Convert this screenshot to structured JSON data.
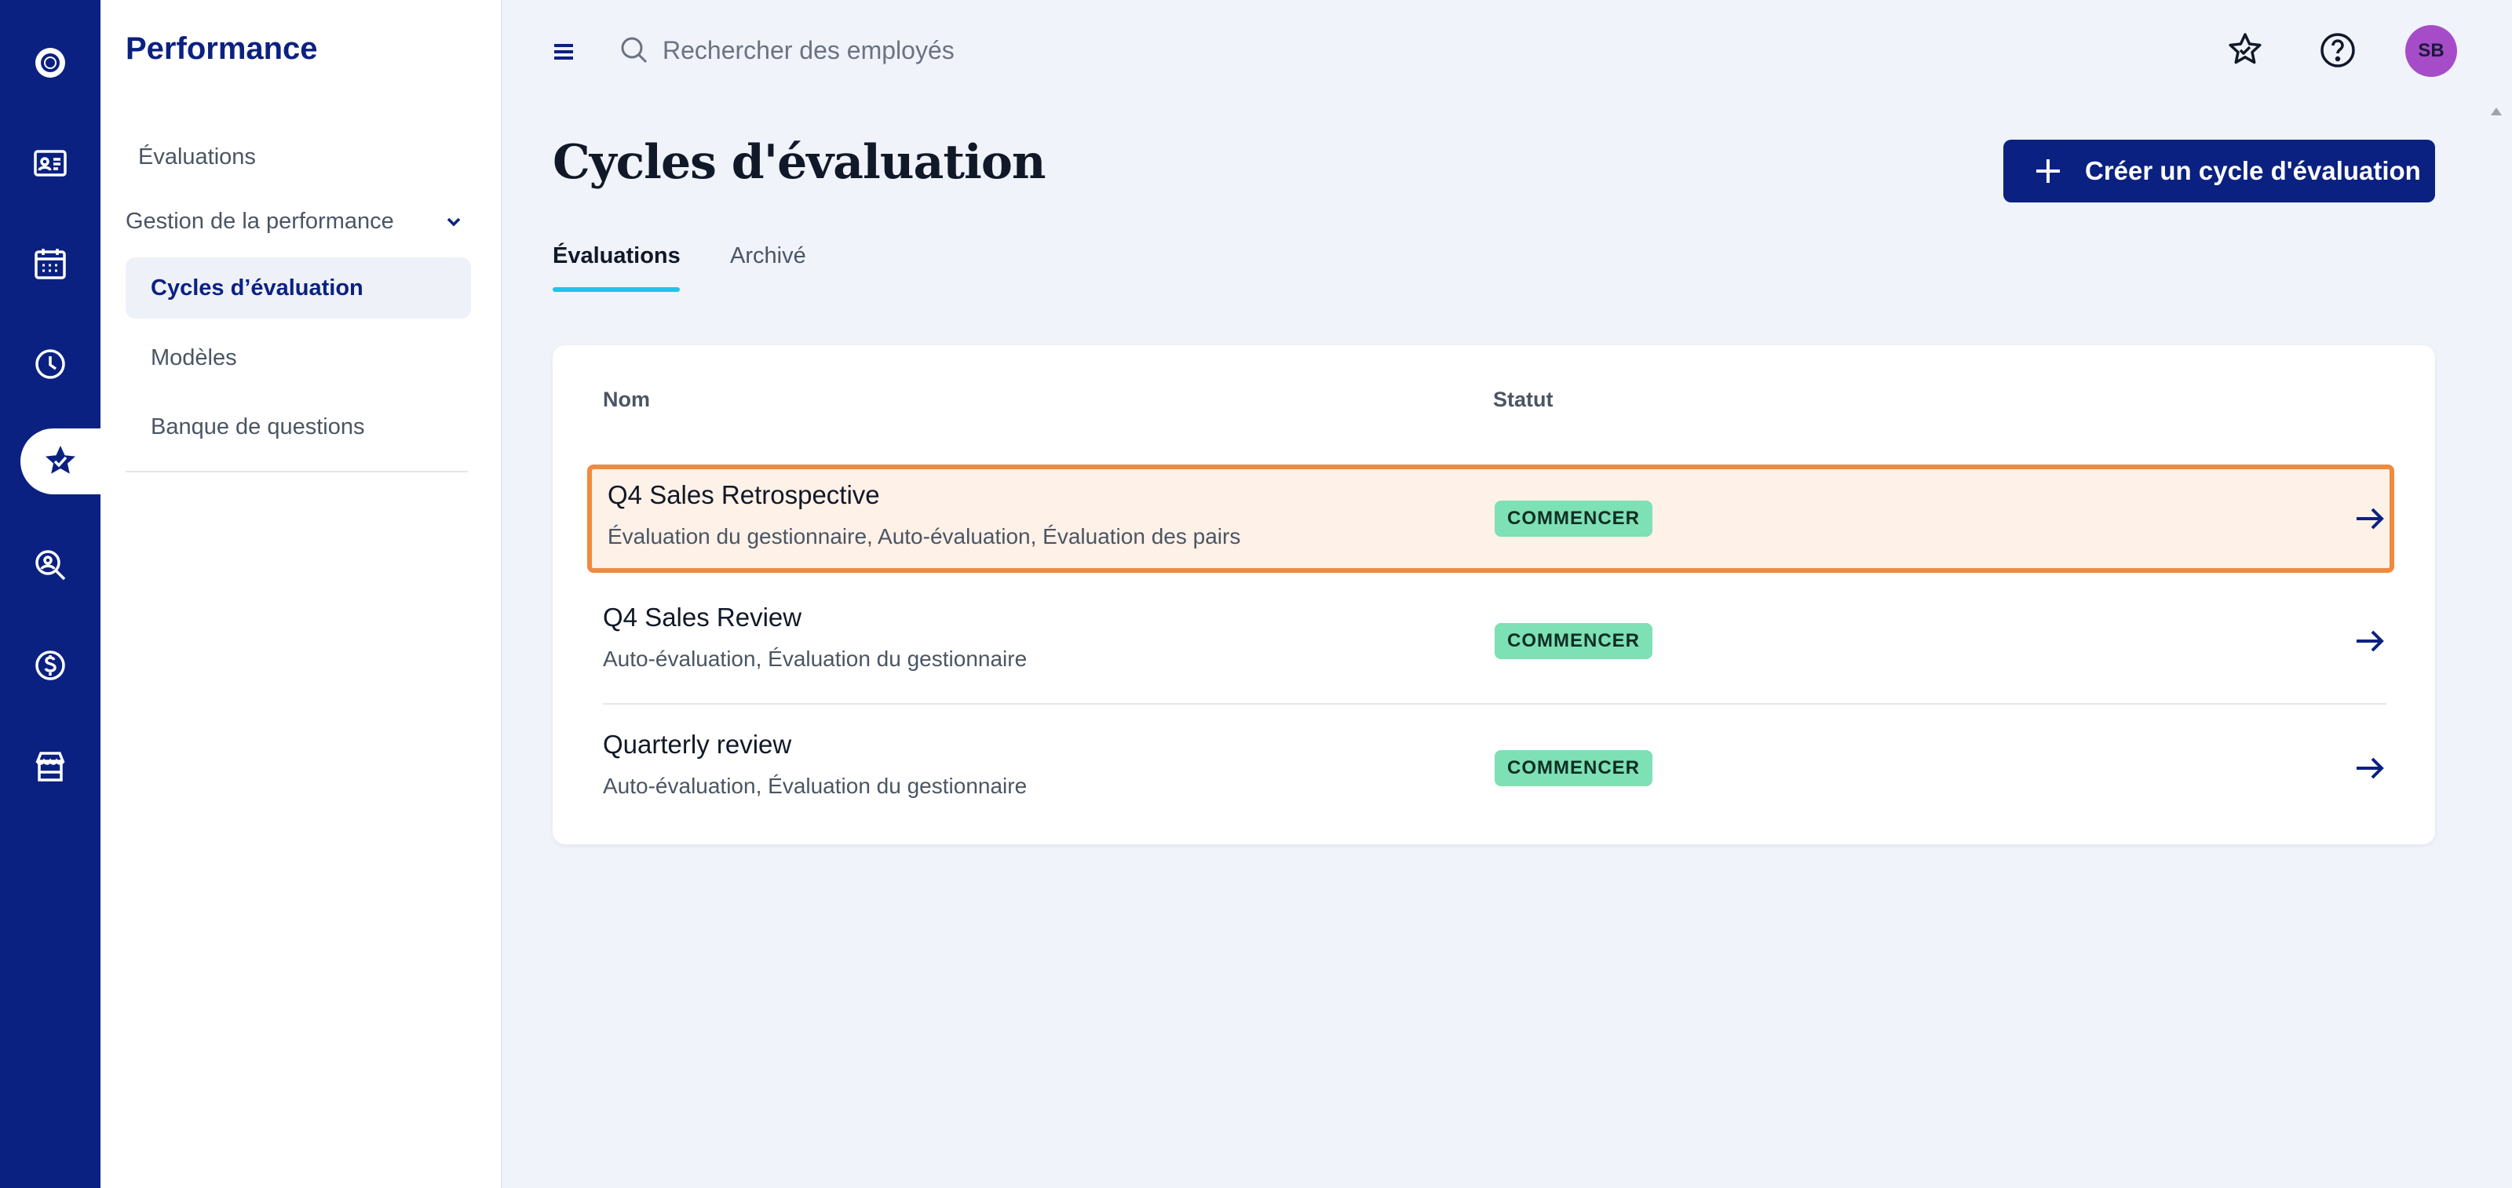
{
  "rail": {
    "items": [
      {
        "icon": "logo-icon"
      },
      {
        "icon": "id-card-icon"
      },
      {
        "icon": "calendar-icon"
      },
      {
        "icon": "clock-icon"
      },
      {
        "icon": "star-check-icon",
        "active": true
      },
      {
        "icon": "person-search-icon"
      },
      {
        "icon": "dollar-icon"
      },
      {
        "icon": "store-icon"
      }
    ]
  },
  "subnav": {
    "title": "Performance",
    "evaluations_label": "Évaluations",
    "group_label": "Gestion de la performance",
    "active_label": "Cycles d’évaluation",
    "children": [
      "Modèles",
      "Banque de questions"
    ]
  },
  "topbar": {
    "search_placeholder": "Rechercher des employés",
    "avatar_initials": "SB"
  },
  "main": {
    "title": "Cycles d'évaluation",
    "create_label": "Créer un cycle d'évaluation",
    "tabs": [
      "Évaluations",
      "Archivé"
    ],
    "columns": {
      "name": "Nom",
      "status": "Statut"
    },
    "rows": [
      {
        "name": "Q4 Sales Retrospective",
        "types": "Évaluation du gestionnaire, Auto-évaluation, Évaluation des pairs",
        "status": "COMMENCER"
      },
      {
        "name": "Q4 Sales Review",
        "types": "Auto-évaluation, Évaluation du gestionnaire",
        "status": "COMMENCER"
      },
      {
        "name": "Quarterly review",
        "types": "Auto-évaluation, Évaluation du gestionnaire",
        "status": "COMMENCER"
      }
    ]
  },
  "colors": {
    "brand": "#0b2181",
    "tab_accent": "#22c3e6",
    "badge": "#7ee0b5",
    "highlight_border": "#ef8a3e",
    "avatar": "#a64cc8"
  }
}
